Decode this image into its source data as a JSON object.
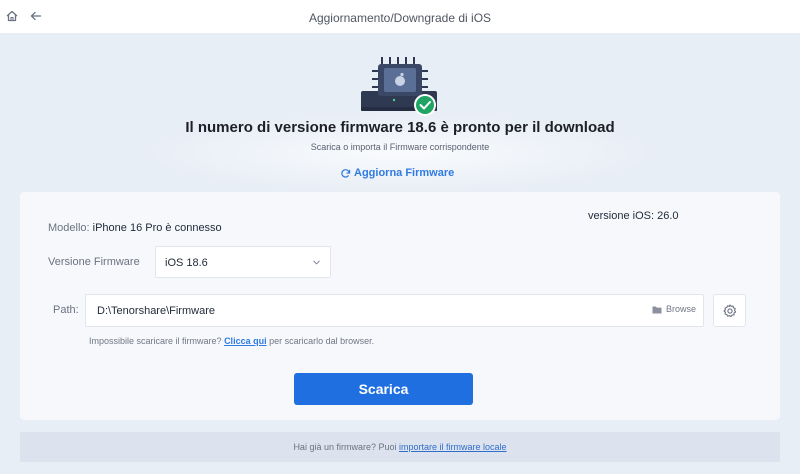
{
  "window": {
    "title": "Aggiornamento/Downgrade di iOS"
  },
  "nav": {
    "home_icon": "home-icon",
    "back_icon": "arrow-left-icon"
  },
  "hero": {
    "headline": "Il numero di versione firmware 18.6 è pronto per il download",
    "subline": "Scarica o importa il Firmware corrispondente",
    "update_link": "Aggiorna Firmware"
  },
  "device": {
    "model_label": "Modello:",
    "model_value": "iPhone 16 Pro è connesso",
    "ios_version": "versione iOS: 26.0"
  },
  "firmware": {
    "label": "Versione Firmware",
    "selected": "iOS 18.6"
  },
  "path": {
    "label": "Path:",
    "value": "D:\\Tenorshare\\Firmware",
    "browse_label": "Browse"
  },
  "hint": {
    "before": "Impossibile scaricare il firmware?",
    "link": "Clicca qui",
    "after": "per scaricarlo dal browser."
  },
  "actions": {
    "download_label": "Scarica"
  },
  "footer": {
    "prefix": "Hai già un firmware? Puoi",
    "link": "importare il firmware locale"
  },
  "colors": {
    "accent": "#1f6fe0",
    "link": "#2f7be2",
    "success": "#1fa463",
    "background": "#e8eef6"
  }
}
